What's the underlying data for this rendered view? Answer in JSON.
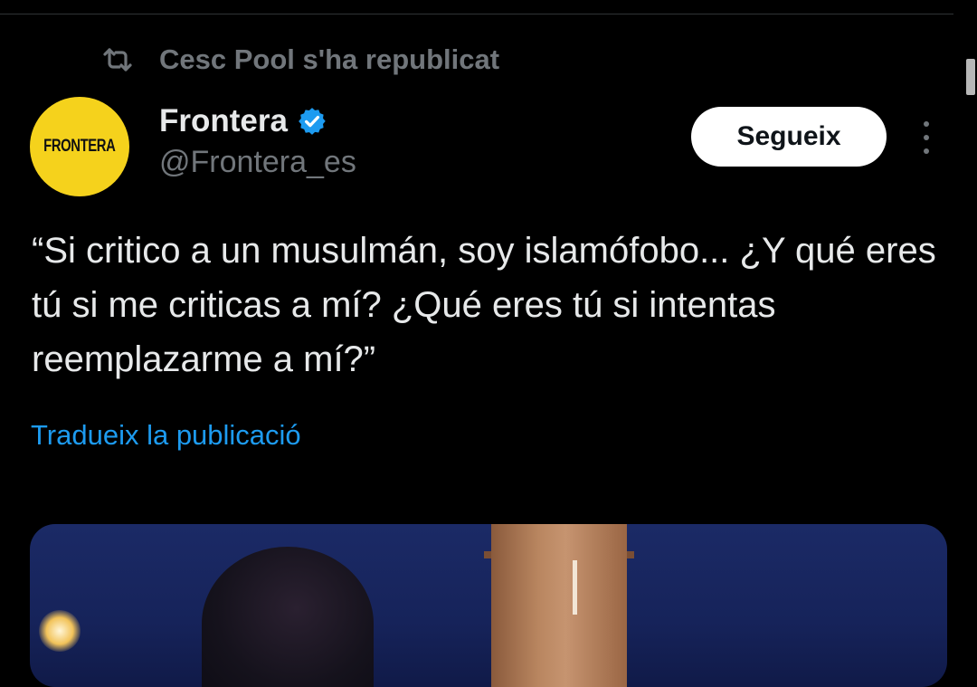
{
  "repost": {
    "icon": "repost-icon",
    "text": "Cesc Pool s'ha republicat"
  },
  "author": {
    "avatar_text": "FRONTERA",
    "avatar_color": "#f5d21c",
    "name": "Frontera",
    "verified_icon": "verified-badge-icon",
    "verified_color": "#1d9bf0",
    "handle": "@Frontera_es"
  },
  "actions": {
    "follow_label": "Segueix",
    "more_icon": "more-vertical-icon"
  },
  "tweet": {
    "text": "“Si critico a un musulmán, soy islamófobo... ¿Y qué eres tú si me criticas a mí? ¿Qué eres tú si intentas reemplazarme a mí?”",
    "translate_label": "Tradueix la publicació"
  },
  "colors": {
    "background": "#000000",
    "text_primary": "#e7e9ea",
    "text_secondary": "#71767b",
    "link": "#1d9bf0"
  }
}
